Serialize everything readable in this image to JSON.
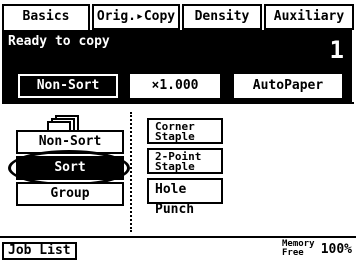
{
  "tabs": [
    {
      "label": "Basics",
      "active": true
    },
    {
      "label": "Orig.▸Copy",
      "active": false
    },
    {
      "label": "Density",
      "active": false
    },
    {
      "label": "Auxiliary",
      "active": false
    }
  ],
  "status": {
    "message": "Ready to copy",
    "copy_count": "1"
  },
  "settings": {
    "sort_mode": "Non-Sort",
    "zoom": "×1.000",
    "paper": "AutoPaper"
  },
  "finishing": {
    "icon": "paper-stack-icon",
    "options": [
      "Non-Sort",
      "Sort",
      "Group"
    ],
    "selected": "Sort"
  },
  "staple": {
    "corner_line1": "Corner",
    "corner_line2": "Staple",
    "twopoint_line1": "2-Point",
    "twopoint_line2": "Staple",
    "hole_punch": "Hole Punch"
  },
  "footer": {
    "job_list": "Job List",
    "memory_line1": "Memory",
    "memory_line2": "Free",
    "memory_value": "100%"
  }
}
